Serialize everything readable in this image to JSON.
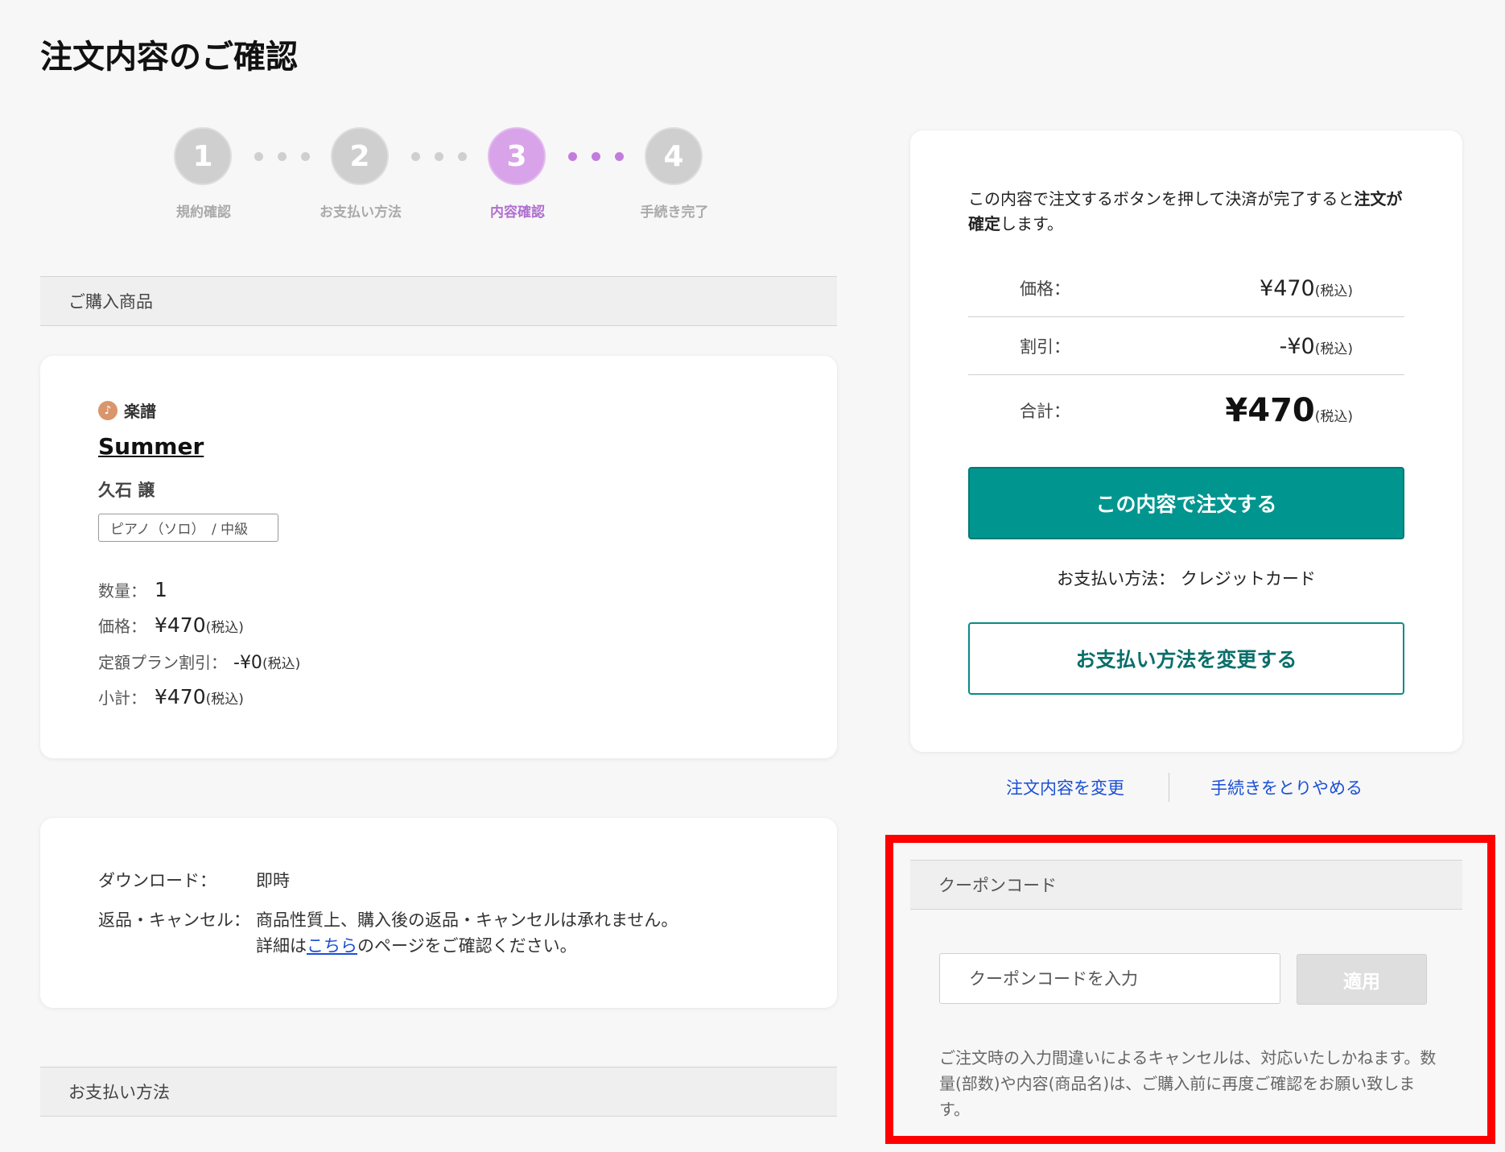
{
  "page": {
    "title": "注文内容のご確認"
  },
  "steps": [
    {
      "number": "1",
      "label": "規約確認"
    },
    {
      "number": "2",
      "label": "お支払い方法"
    },
    {
      "number": "3",
      "label": "内容確認"
    },
    {
      "number": "4",
      "label": "手続き完了"
    }
  ],
  "purchase_section": {
    "title": "ご購入商品"
  },
  "product": {
    "category": "楽譜",
    "title": "Summer",
    "artist": "久石 譲",
    "tag": "ピアノ（ソロ）　/ 中級",
    "quantity_label": "数量：",
    "quantity": "1",
    "price_label": "価格：",
    "price": "¥470",
    "discount_label": "定額プラン割引：",
    "discount": "-¥0",
    "subtotal_label": "小計：",
    "subtotal": "¥470",
    "tax_note": "(税込)"
  },
  "info": {
    "download_label": "ダウンロード：",
    "download_value": "即時",
    "return_label": "返品・キャンセル：",
    "return_value": "商品性質上、購入後の返品・キャンセルは承れません。",
    "detail_prefix": "詳細は",
    "detail_link": "こちら",
    "detail_suffix": "のページをご確認ください。"
  },
  "payment_section": {
    "title": "お支払い方法"
  },
  "summary": {
    "notice_part1": "この内容で注文するボタンを押して決済が完了すると",
    "notice_bold": "注文が確定",
    "notice_part2": "します。",
    "price_label": "価格：",
    "price": "¥470",
    "discount_label": "割引：",
    "discount": "-¥0",
    "total_label": "合計：",
    "total": "¥470",
    "tax_note": "(税込)",
    "order_button": "この内容で注文する",
    "payment_method_label": "お支払い方法：",
    "payment_method": "クレジットカード",
    "change_payment_button": "お支払い方法を変更する"
  },
  "links": {
    "change_order": "注文内容を変更",
    "cancel_procedure": "手続きをとりやめる"
  },
  "coupon": {
    "title": "クーポンコード",
    "placeholder": "クーポンコードを入力",
    "apply_button": "適用",
    "note": "ご注文時の入力間違いによるキャンセルは、対応いたしかねます。数量(部数)や内容(商品名)は、ご購入前に再度ご確認をお願い致します。"
  },
  "colors": {
    "accent": "#00968f",
    "step_active": "#d8a3e8",
    "highlight": "#ff0000",
    "link": "#1a4fd6"
  }
}
